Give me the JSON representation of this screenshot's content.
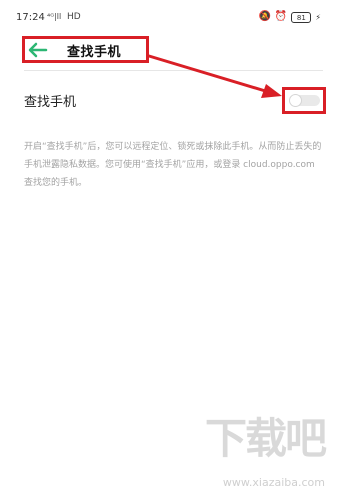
{
  "status_bar": {
    "time": "17:24",
    "signal": "⁴ᴳ|ll",
    "network": "HD",
    "battery": "81"
  },
  "header": {
    "title": "查找手机"
  },
  "setting": {
    "label": "查找手机",
    "enabled": false
  },
  "description": "开启“查找手机”后，您可以远程定位、锁死或抹除此手机。从而防止丢失的手机泄露隐私数据。您可使用“查找手机”应用，或登录 cloud.oppo.com 查找您的手机。",
  "watermark": {
    "brand": "下载吧",
    "site": "www.xiazaiba.com"
  },
  "colors": {
    "accent": "#2bb673",
    "annotation": "#d91f26",
    "muted_text": "#a3a3a3"
  }
}
